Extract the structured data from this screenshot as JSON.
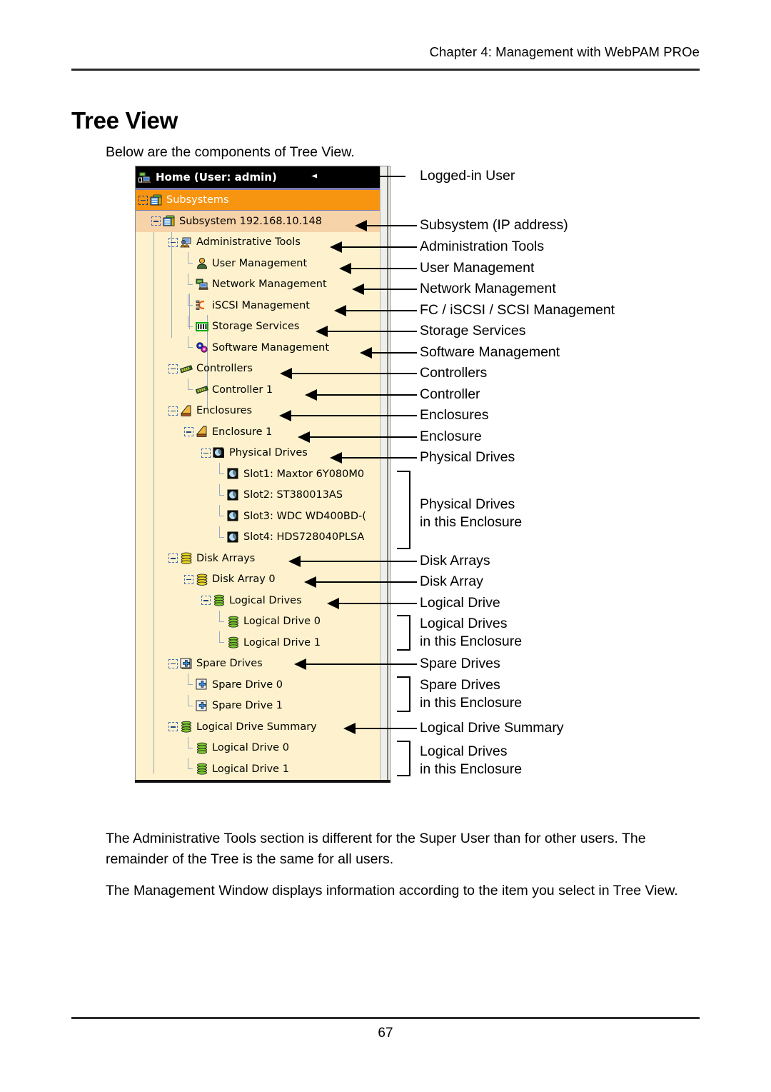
{
  "running_head": "Chapter 4: Management with WebPAM PROe",
  "page_title": "Tree View",
  "intro": "Below are the components of Tree View.",
  "paragraphs": {
    "p1": "The Administrative Tools section is different for the Super User than for other users. The remainder of the Tree is the same for all users.",
    "p2": "The Management Window displays information according to the item you select in Tree View."
  },
  "page_number": "67",
  "tree": {
    "header": "Home (User: admin)",
    "nodes": [
      {
        "label": "Subsystems",
        "icon": "subsystems-icon",
        "state": "selected"
      },
      {
        "label": "Subsystem 192.168.10.148",
        "icon": "subsystem-icon",
        "state": "highlight"
      },
      {
        "label": "Administrative Tools",
        "icon": "admin-tools-icon"
      },
      {
        "label": "User Management",
        "icon": "user-management-icon"
      },
      {
        "label": "Network Management",
        "icon": "network-management-icon"
      },
      {
        "label": "iSCSI Management",
        "icon": "iscsi-management-icon"
      },
      {
        "label": "Storage Services",
        "icon": "storage-services-icon"
      },
      {
        "label": "Software Management",
        "icon": "software-management-icon"
      },
      {
        "label": "Controllers",
        "icon": "controller-icon"
      },
      {
        "label": "Controller 1",
        "icon": "controller-icon"
      },
      {
        "label": "Enclosures",
        "icon": "enclosure-icon"
      },
      {
        "label": "Enclosure 1",
        "icon": "enclosure-icon"
      },
      {
        "label": "Physical Drives",
        "icon": "physical-drives-icon"
      },
      {
        "label": "Slot1: Maxtor 6Y080M0",
        "icon": "physical-drive-icon"
      },
      {
        "label": "Slot2: ST380013AS",
        "icon": "physical-drive-icon"
      },
      {
        "label": "Slot3: WDC WD400BD-(",
        "icon": "physical-drive-icon"
      },
      {
        "label": "Slot4: HDS728040PLSA",
        "icon": "physical-drive-icon"
      },
      {
        "label": "Disk Arrays",
        "icon": "disk-array-icon"
      },
      {
        "label": "Disk Array 0",
        "icon": "disk-array-icon"
      },
      {
        "label": "Logical Drives",
        "icon": "logical-drive-icon"
      },
      {
        "label": "Logical Drive 0",
        "icon": "logical-drive-icon"
      },
      {
        "label": "Logical Drive 1",
        "icon": "logical-drive-icon"
      },
      {
        "label": "Spare Drives",
        "icon": "spare-drive-icon"
      },
      {
        "label": "Spare Drive 0",
        "icon": "spare-drive-icon"
      },
      {
        "label": "Spare Drive 1",
        "icon": "spare-drive-icon"
      },
      {
        "label": "Logical Drive Summary",
        "icon": "logical-drive-icon"
      },
      {
        "label": "Logical Drive 0",
        "icon": "logical-drive-icon"
      },
      {
        "label": "Logical Drive 1",
        "icon": "logical-drive-icon"
      }
    ]
  },
  "annotations": [
    {
      "text": "Logged-in User",
      "marker": "hollow-arrow"
    },
    {
      "text": "Subsystem (IP address)",
      "marker": "arrow"
    },
    {
      "text": "Administration Tools",
      "marker": "arrow"
    },
    {
      "text": "User Management",
      "marker": "arrow"
    },
    {
      "text": "Network Management",
      "marker": "arrow"
    },
    {
      "text": "FC / iSCSI / SCSI Management",
      "marker": "arrow"
    },
    {
      "text": "Storage Services",
      "marker": "arrow"
    },
    {
      "text": "Software Management",
      "marker": "arrow"
    },
    {
      "text": "Controllers",
      "marker": "arrow"
    },
    {
      "text": "Controller",
      "marker": "arrow"
    },
    {
      "text": "Enclosures",
      "marker": "arrow"
    },
    {
      "text": "Enclosure",
      "marker": "arrow"
    },
    {
      "text": "Physical Drives",
      "marker": "arrow"
    },
    {
      "text": "Physical Drives\nin this Enclosure",
      "marker": "bracket"
    },
    {
      "text": "Disk Arrays",
      "marker": "arrow"
    },
    {
      "text": "Disk Array",
      "marker": "arrow"
    },
    {
      "text": "Logical Drive",
      "marker": "arrow"
    },
    {
      "text": "Logical Drives\nin this Enclosure",
      "marker": "bracket"
    },
    {
      "text": "Spare Drives",
      "marker": "arrow"
    },
    {
      "text": "Spare Drives\nin this Enclosure",
      "marker": "bracket"
    },
    {
      "text": "Logical Drive Summary",
      "marker": "arrow"
    },
    {
      "text": "Logical Drives\nin this Enclosure",
      "marker": "bracket"
    }
  ],
  "colors": {
    "selection": "#f79410",
    "subsystem_row": "#f6d3a8",
    "panel_bg": "#fdf2cd",
    "header_bg": "#000000"
  }
}
